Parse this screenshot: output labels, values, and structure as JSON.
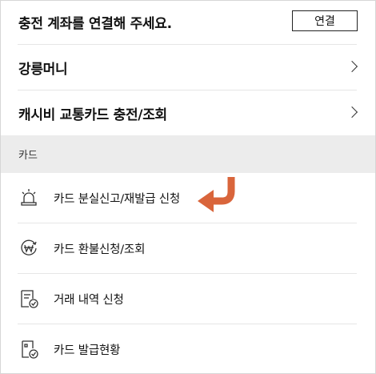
{
  "header": {
    "title": "충전 계좌를 연결해 주세요.",
    "connect_button": "연결"
  },
  "menu": [
    {
      "label": "강릉머니"
    },
    {
      "label": "캐시비 교통카드 충전/조회"
    }
  ],
  "section": {
    "title": "카드",
    "items": [
      {
        "label": "카드 분실신고/재발급 신청",
        "icon": "siren-icon"
      },
      {
        "label": "카드 환불신청/조회",
        "icon": "won-refund-icon"
      },
      {
        "label": "거래 내역 신청",
        "icon": "document-check-icon"
      },
      {
        "label": "카드 발급현황",
        "icon": "card-issue-icon"
      }
    ]
  },
  "colors": {
    "accent_arrow": "#d9653b",
    "section_bg": "#ececec"
  }
}
